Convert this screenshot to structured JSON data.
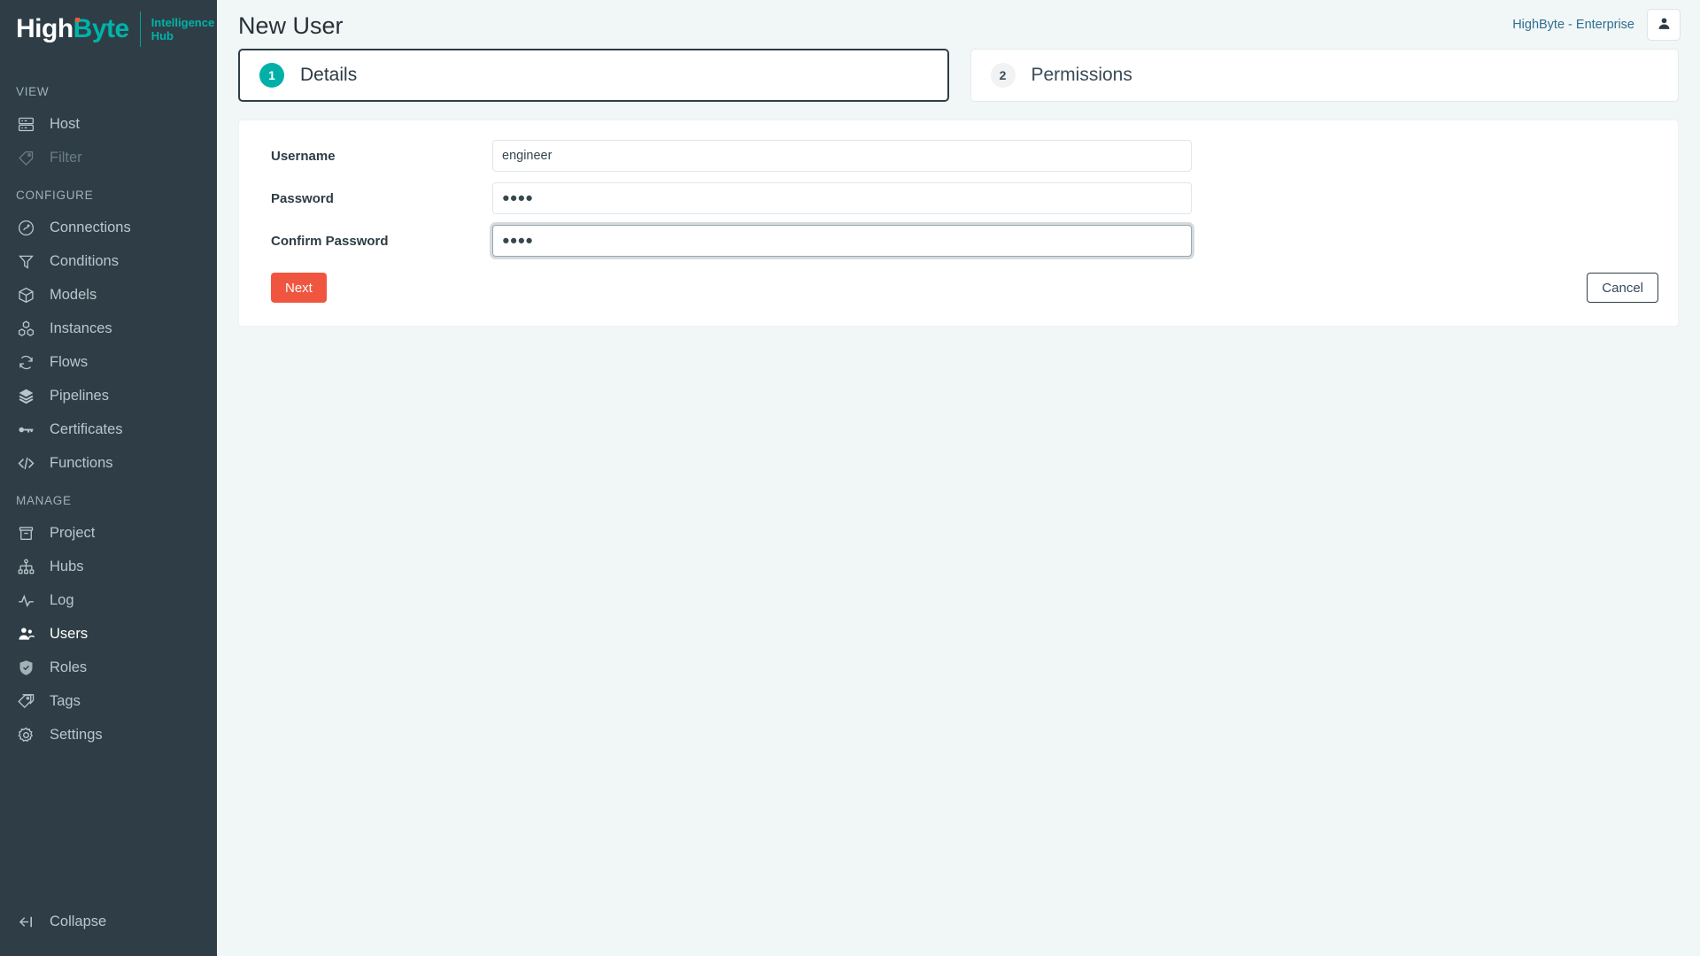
{
  "brand": {
    "name_part1": "High",
    "name_part2": "Byte",
    "subtitle_line1": "Intelligence",
    "subtitle_line2": "Hub"
  },
  "sidebar": {
    "sections": [
      {
        "title": "VIEW",
        "items": [
          {
            "label": "Host",
            "icon": "server-icon",
            "state": "normal"
          },
          {
            "label": "Filter",
            "icon": "tag-icon",
            "state": "disabled"
          }
        ]
      },
      {
        "title": "CONFIGURE",
        "items": [
          {
            "label": "Connections",
            "icon": "plug-icon",
            "state": "normal"
          },
          {
            "label": "Conditions",
            "icon": "funnel-icon",
            "state": "normal"
          },
          {
            "label": "Models",
            "icon": "box-icon",
            "state": "normal"
          },
          {
            "label": "Instances",
            "icon": "cubes-icon",
            "state": "normal"
          },
          {
            "label": "Flows",
            "icon": "refresh-icon",
            "state": "normal"
          },
          {
            "label": "Pipelines",
            "icon": "layers-icon",
            "state": "normal"
          },
          {
            "label": "Certificates",
            "icon": "key-icon",
            "state": "normal"
          },
          {
            "label": "Functions",
            "icon": "code-icon",
            "state": "normal"
          }
        ]
      },
      {
        "title": "MANAGE",
        "items": [
          {
            "label": "Project",
            "icon": "archive-icon",
            "state": "normal"
          },
          {
            "label": "Hubs",
            "icon": "sitemap-icon",
            "state": "normal"
          },
          {
            "label": "Log",
            "icon": "activity-icon",
            "state": "normal"
          },
          {
            "label": "Users",
            "icon": "users-icon",
            "state": "active"
          },
          {
            "label": "Roles",
            "icon": "shield-check-icon",
            "state": "normal"
          },
          {
            "label": "Tags",
            "icon": "tags-icon",
            "state": "normal"
          },
          {
            "label": "Settings",
            "icon": "gear-icon",
            "state": "normal"
          }
        ]
      }
    ],
    "collapse": {
      "label": "Collapse",
      "icon": "collapse-left-icon"
    }
  },
  "topbar": {
    "title": "New User",
    "license": "HighByte - Enterprise",
    "avatar_icon": "user-icon"
  },
  "steps": [
    {
      "number": "1",
      "label": "Details",
      "state": "active"
    },
    {
      "number": "2",
      "label": "Permissions",
      "state": "inactive"
    }
  ],
  "form": {
    "fields": [
      {
        "label": "Username",
        "value": "engineer",
        "type": "text",
        "placeholder": "",
        "focused": false
      },
      {
        "label": "Password",
        "value": "●●●●",
        "type": "password",
        "placeholder": "",
        "focused": false
      },
      {
        "label": "Confirm Password",
        "value": "●●●●",
        "type": "password",
        "placeholder": "",
        "focused": true
      }
    ],
    "next_label": "Next",
    "cancel_label": "Cancel"
  },
  "colors": {
    "brand_teal": "#00b3aa",
    "accent_orange": "#f0563f",
    "sidebar_bg": "#2f3e46",
    "page_bg": "#f1f6f6",
    "link_blue": "#2e6f91"
  }
}
